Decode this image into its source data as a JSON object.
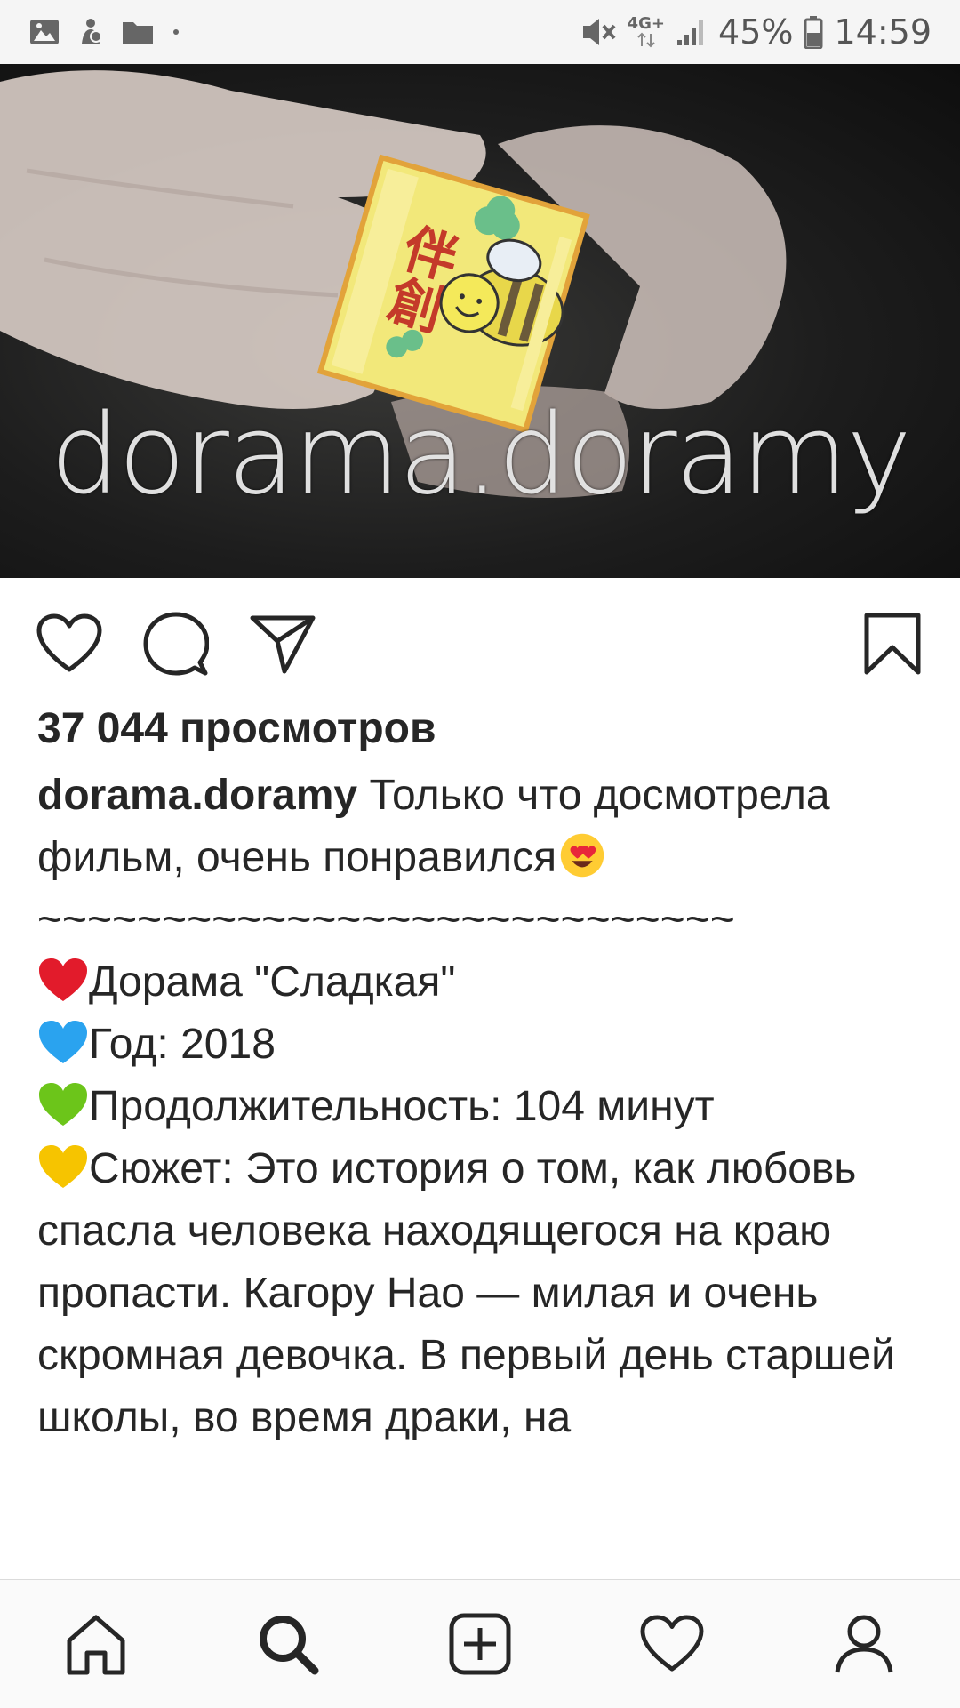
{
  "status_bar": {
    "network": "4G+",
    "battery": "45%",
    "time": "14:59",
    "icons": [
      "image-icon",
      "notification-icon",
      "folder-icon",
      "dot-icon",
      "mute-icon",
      "signal-icon",
      "battery-icon"
    ]
  },
  "media": {
    "watermark": "dorama.doramy"
  },
  "actions": {
    "icons": [
      "heart-icon",
      "comment-icon",
      "share-icon",
      "bookmark-icon"
    ]
  },
  "post": {
    "views": "37 044 просмотров",
    "username": "dorama.doramy",
    "caption_intro_1": " Только что досмотрела фильм, очень понравился",
    "separator": "~~~~~~~~~~~~~~~~~~~~~~~~~~~~",
    "line_title": "Дорама \"Сладкая\"",
    "line_year": "Год: 2018",
    "line_duration": "Продолжительность: 104 минут",
    "line_plot": "Сюжет: Это история о том, как любовь спасла человека находящегося на краю пропасти. Кагору Нао — милая и очень скромная девочка. В первый день старшей школы, во время драки, на",
    "emoji": [
      "heart-eyes-emoji",
      "red-heart-emoji",
      "blue-heart-emoji",
      "green-heart-emoji",
      "yellow-heart-emoji"
    ]
  },
  "bottom_nav": {
    "icons": [
      "home-icon",
      "search-icon",
      "add-post-icon",
      "activity-heart-icon",
      "profile-icon"
    ]
  },
  "colors": {
    "text": "#262626",
    "statusbar_bg": "#f5f5f5",
    "nav_bg": "#fafafa"
  }
}
